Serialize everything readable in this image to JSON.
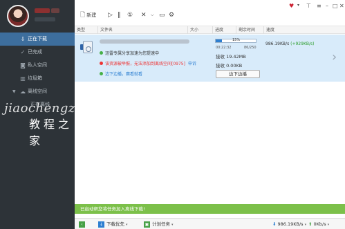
{
  "toolbar": {
    "new_label": "新建",
    "icons": [
      "new-icon",
      "play-icon",
      "pause-icon",
      "limit-icon",
      "delete-icon",
      "folder-icon",
      "settings-icon"
    ]
  },
  "window_controls": [
    "skin-icon",
    "minimize-to-tray-icon",
    "menu-icon",
    "minimize-icon",
    "maximize-icon",
    "close-icon"
  ],
  "sidebar": {
    "items": [
      {
        "label": "正在下载",
        "icon": "download-icon",
        "active": true
      },
      {
        "label": "已完成",
        "icon": "check-icon"
      },
      {
        "label": "私人空间",
        "icon": "lock-icon"
      },
      {
        "label": "垃圾箱",
        "icon": "trash-icon"
      },
      {
        "label": "离线空间",
        "icon": "cloud-icon",
        "expanded": true
      },
      {
        "label": "正在离线",
        "icon": "",
        "sub": true
      }
    ]
  },
  "watermark": {
    "line1": "jiaochengzhiji",
    "line2": "教程之家"
  },
  "table": {
    "headers": [
      "类型",
      "文件名",
      "大小",
      "进度",
      "剩余时间",
      "速度"
    ]
  },
  "task": {
    "progress_pct": 15,
    "progress_text": "15%",
    "elapsed": "00:22:32",
    "done_count": "86/250",
    "speed": "986.19KB/s",
    "accel": "(+929KB/s)",
    "received_label": "接收 19.42MB",
    "received2_label": "接收 0.00KB",
    "status_lines": {
      "accel_line": "迅雷专属分享加速为您提速中",
      "error_line": "该资源被举报，无法添加到离线空间[0975]",
      "appeal": "申诉",
      "play_line": "边下边播，赛看就看"
    },
    "play_button": "边下边播"
  },
  "notice": "已启动帮您将任务加入离线下载!",
  "status_bar": {
    "download_priority": "下载优先",
    "scheduled_task": "计划任务",
    "down_speed": "986.19KB/s",
    "up_speed": "0Kb/s"
  },
  "colors": {
    "sidebar_bg": "#2d3338",
    "active_item": "#3d6e9d",
    "row_bg": "#d8ebfa",
    "notice_bg": "#7cc04a",
    "error_text": "#e33333",
    "link_text": "#2d7fd1"
  }
}
